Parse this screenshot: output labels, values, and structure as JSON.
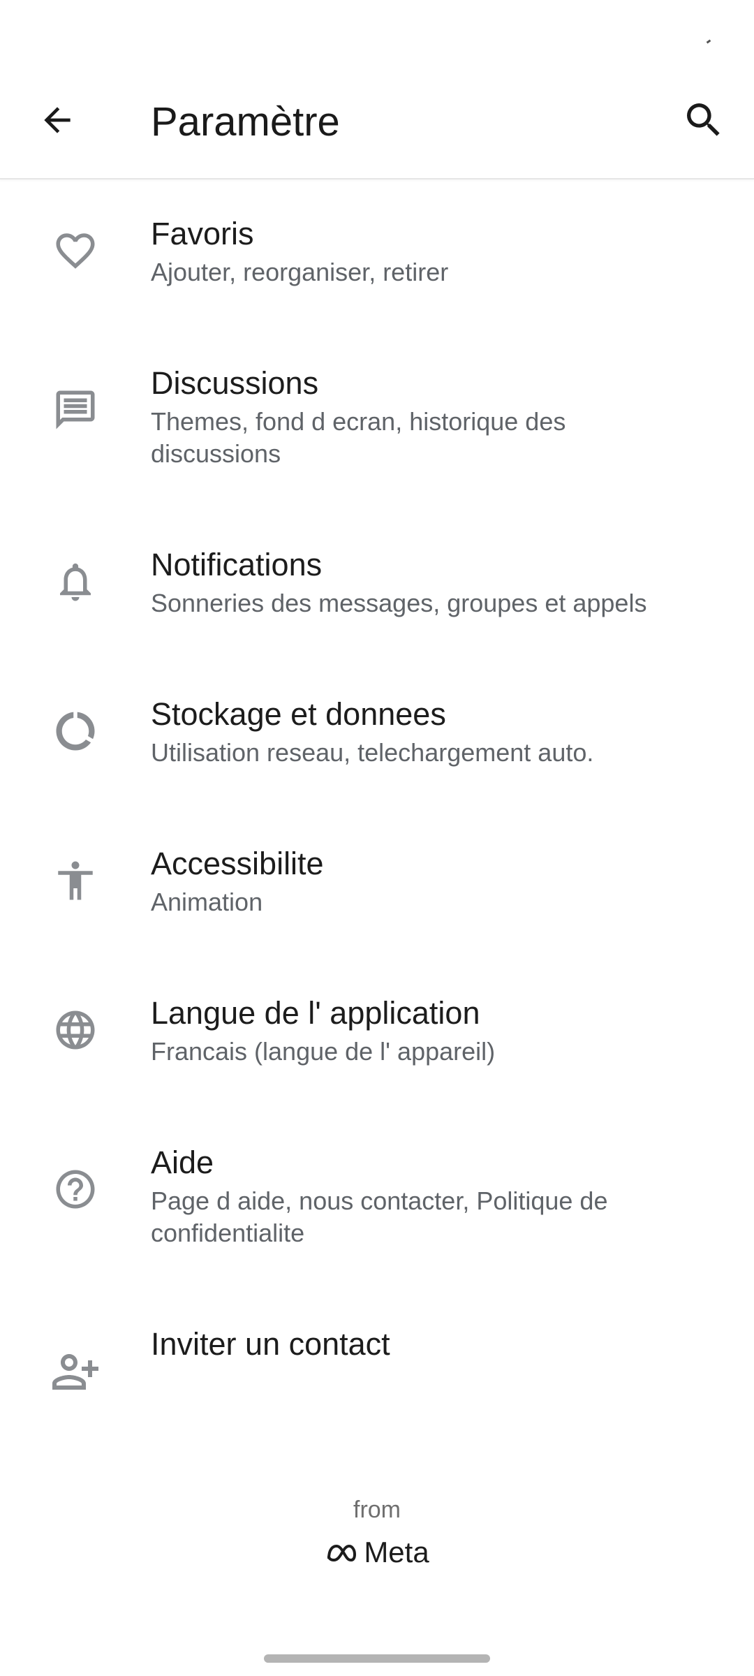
{
  "header": {
    "title": "Paramètre",
    "back_icon": "arrow-back-icon",
    "search_icon": "search-icon"
  },
  "settings": [
    {
      "icon": "heart-icon",
      "title": "Favoris",
      "subtitle": "Ajouter, reorganiser, retirer"
    },
    {
      "icon": "chat-icon",
      "title": "Discussions",
      "subtitle": "Themes, fond d ecran, historique des discussions"
    },
    {
      "icon": "bell-icon",
      "title": "Notifications",
      "subtitle": "Sonneries des messages, groupes et appels"
    },
    {
      "icon": "data-usage-icon",
      "title": "Stockage et donnees",
      "subtitle": "Utilisation reseau, telechargement auto."
    },
    {
      "icon": "accessibility-icon",
      "title": "Accessibilite",
      "subtitle": "Animation"
    },
    {
      "icon": "globe-icon",
      "title": "Langue de l' application",
      "subtitle": "Francais (langue de l' appareil)"
    },
    {
      "icon": "help-icon",
      "title": "Aide",
      "subtitle": "Page d aide, nous contacter, Politique de confidentialite"
    },
    {
      "icon": "add-contact-icon",
      "title": "Inviter un contact"
    }
  ],
  "footer": {
    "from": "from",
    "brand": "Meta"
  },
  "colors": {
    "icon": "#8a8d91",
    "title": "#1c1c1c",
    "subtitle": "#5f6368",
    "divider": "#e6e6e6"
  }
}
